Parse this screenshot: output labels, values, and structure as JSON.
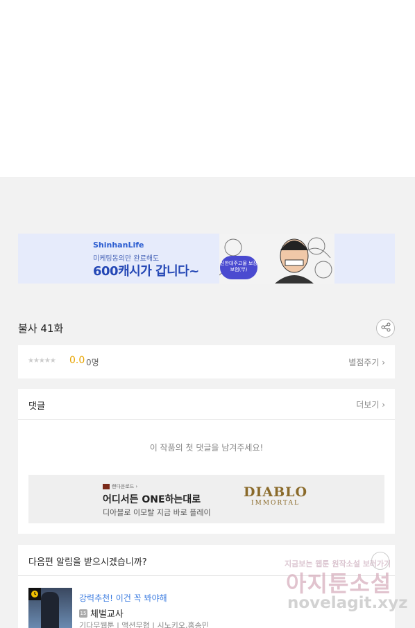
{
  "banner": {
    "brand": "ShinhanLife",
    "sub": "미케팅동의만 완료해도",
    "headline": "600캐시가 갑니다~",
    "pill": "신한대주고물 보장보험(무)"
  },
  "episode": {
    "title": "불사 41화",
    "share_icon": "share-icon"
  },
  "rating": {
    "stars": "★★★★★",
    "score": "0.0",
    "count": "0명",
    "rate_label": "별점주기 ›"
  },
  "comments": {
    "label": "댓글",
    "more_label": "더보기 ›",
    "empty_message": "이 작품의 첫 댓글을 남겨주세요!"
  },
  "ad": {
    "source": "랜다운로드 ›",
    "title": "어디서든 ONE하는대로",
    "description": "디아블로 이모탈 지금 바로 플레이",
    "logo_line1": "DIABLO",
    "logo_line2": "IMMORTAL"
  },
  "notify": {
    "question": "다음편 알림을 받으시겠습니까?"
  },
  "recommendation": {
    "tag": "강력추천! 이건 꼭 봐야해",
    "age_badge": "15",
    "title": "체벌교사",
    "meta": "기다무웹툰 | 액션무협 | 시노키오,홍송민"
  },
  "watermark": {
    "line1": "지금보는 웹툰 원작소설 보러가기",
    "line2": "아지툰소설",
    "line3": "novelagit.xyz"
  },
  "colors": {
    "accent_blue": "#3a7be0",
    "score_gold": "#e8a400",
    "banner_bg": "#e6ebfb"
  }
}
